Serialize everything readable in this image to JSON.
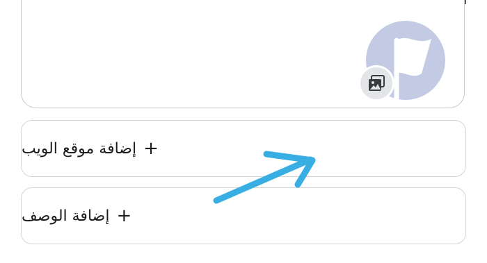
{
  "header": {
    "avatar_icon": "flag-icon",
    "camera_icon": "photo-icon"
  },
  "rows": [
    {
      "plus": "+",
      "label": "إضافة موقع الويب"
    },
    {
      "plus": "+",
      "label": "إضافة الوصف"
    }
  ],
  "annotation": {
    "arrow_color": "#38aee3"
  },
  "colors": {
    "avatar_bg": "#c3cbe4",
    "badge_bg": "#e4e5e9"
  }
}
